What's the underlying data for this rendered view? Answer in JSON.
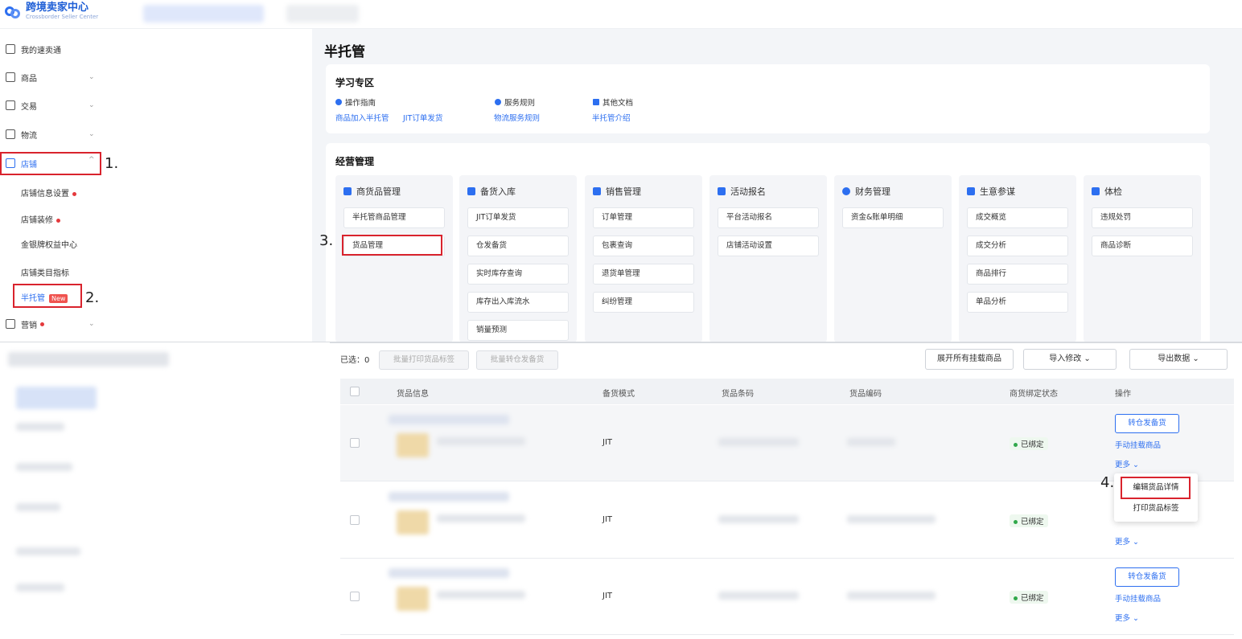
{
  "header": {
    "app_title": "跨境卖家中心",
    "app_subtitle": "Crossborder Seller Center"
  },
  "sidebar": {
    "items": [
      {
        "label": "我的速卖通"
      },
      {
        "label": "商品"
      },
      {
        "label": "交易"
      },
      {
        "label": "物流"
      },
      {
        "label": "店铺"
      },
      {
        "label": "营销"
      }
    ],
    "sub_items": [
      {
        "label": "店铺信息设置"
      },
      {
        "label": "店铺装修"
      },
      {
        "label": "金银牌权益中心"
      },
      {
        "label": "店铺类目指标"
      },
      {
        "label": "半托管",
        "badge": "New"
      }
    ]
  },
  "steps": [
    "1.",
    "2.",
    "3.",
    "4."
  ],
  "page": {
    "title": "半托管"
  },
  "study": {
    "title": "学习专区",
    "groups": [
      {
        "heading": "操作指南",
        "links": [
          "商品加入半托管",
          "JIT订单发货"
        ]
      },
      {
        "heading": "服务规则",
        "links": [
          "物流服务规则"
        ]
      },
      {
        "heading": "其他文档",
        "links": [
          "半托管介绍"
        ]
      }
    ]
  },
  "ops": {
    "title": "经营管理",
    "columns": [
      {
        "heading": "商货品管理",
        "items": [
          "半托管商品管理",
          "货品管理"
        ]
      },
      {
        "heading": "备货入库",
        "items": [
          "JIT订单发货",
          "仓发备货",
          "实时库存查询",
          "库存出入库流水",
          "销量预测"
        ]
      },
      {
        "heading": "销售管理",
        "items": [
          "订单管理",
          "包裹查询",
          "退货单管理",
          "纠纷管理"
        ]
      },
      {
        "heading": "活动报名",
        "items": [
          "平台活动报名",
          "店铺活动设置"
        ]
      },
      {
        "heading": "财务管理",
        "items": [
          "资金&账单明细"
        ]
      },
      {
        "heading": "生意参谋",
        "items": [
          "成交概览",
          "成交分析",
          "商品排行",
          "单品分析"
        ]
      },
      {
        "heading": "体检",
        "items": [
          "违规处罚",
          "商品诊断"
        ]
      }
    ]
  },
  "toolbar": {
    "selected_label": "已选：0",
    "batch_print": "批量打印货品标签",
    "batch_transfer": "批量转仓发备货",
    "expand_all": "展开所有挂载商品",
    "import_edit": "导入修改 ⌄",
    "export_data": "导出数据 ⌄"
  },
  "table": {
    "headers": [
      "货品信息",
      "备货模式",
      "货品条码",
      "货品编码",
      "商货绑定状态",
      "操作"
    ],
    "rows": [
      {
        "mode": "JIT",
        "status": "已绑定"
      },
      {
        "mode": "JIT",
        "status": "已绑定"
      },
      {
        "mode": "JIT",
        "status": "已绑定"
      }
    ],
    "actions": {
      "transfer": "转仓发备货",
      "mount": "手动挂载商品",
      "more": "更多 ⌄"
    }
  },
  "dropdown": {
    "items": [
      "编辑货品详情",
      "打印货品标签"
    ]
  },
  "colors": {
    "accent": "#2d6ff0",
    "highlight": "#d9232d",
    "bound": "#30a84a"
  }
}
